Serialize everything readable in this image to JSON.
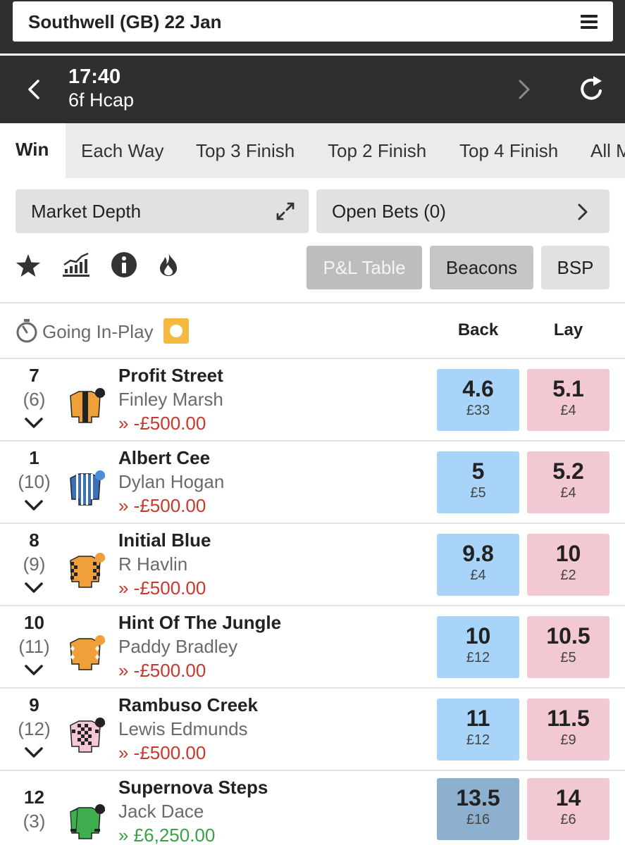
{
  "header": {
    "meeting_title": "Southwell (GB) 22 Jan",
    "menu_icon": "hamburger-menu-icon"
  },
  "race": {
    "time": "17:40",
    "description": "6f Hcap",
    "prev_icon": "chevron-left-icon",
    "next_icon": "chevron-right-icon",
    "refresh_icon": "refresh-icon"
  },
  "tabs": [
    {
      "label": "Win",
      "active": true
    },
    {
      "label": "Each Way"
    },
    {
      "label": "Top 3 Finish"
    },
    {
      "label": "Top 2 Finish"
    },
    {
      "label": "Top 4 Finish"
    },
    {
      "label": "All M"
    }
  ],
  "controls": {
    "market_depth_label": "Market Depth",
    "open_bets_label": "Open Bets",
    "open_bets_count": "(0)",
    "pl_table_label": "P&L Table",
    "beacons_label": "Beacons",
    "bsp_label": "BSP"
  },
  "icons": [
    "star-icon",
    "chart-icon",
    "info-icon",
    "flame-icon"
  ],
  "market": {
    "in_play_label": "Going In-Play",
    "back_header": "Back",
    "lay_header": "Lay"
  },
  "colors": {
    "back": "#a9d4f9",
    "back_selected": "#8eb0cf",
    "lay": "#f2c9d2",
    "loss": "#c8382e",
    "profit": "#3aa146",
    "in_play_badge": "#f5b942"
  },
  "runners": [
    {
      "number": "7",
      "draw": "(6)",
      "name": "Profit Street",
      "jockey": "Finley Marsh",
      "pl": "» -£500.00",
      "pl_sign": "neg",
      "back_odds": "4.6",
      "back_stake": "£33",
      "lay_odds": "5.1",
      "lay_stake": "£4",
      "silk": "orange-black-stripe"
    },
    {
      "number": "1",
      "draw": "(10)",
      "name": "Albert Cee",
      "jockey": "Dylan Hogan",
      "pl": "» -£500.00",
      "pl_sign": "neg",
      "back_odds": "5",
      "back_stake": "£5",
      "lay_odds": "5.2",
      "lay_stake": "£4",
      "silk": "blue-white-stripes"
    },
    {
      "number": "8",
      "draw": "(9)",
      "name": "Initial Blue",
      "jockey": "R Havlin",
      "pl": "» -£500.00",
      "pl_sign": "neg",
      "back_odds": "9.8",
      "back_stake": "£4",
      "lay_odds": "10",
      "lay_stake": "£2",
      "silk": "orange-check-sleeves"
    },
    {
      "number": "10",
      "draw": "(11)",
      "name": "Hint Of The Jungle",
      "jockey": "Paddy Bradley",
      "pl": "» -£500.00",
      "pl_sign": "neg",
      "back_odds": "10",
      "back_stake": "£12",
      "lay_odds": "10.5",
      "lay_stake": "£5",
      "silk": "orange-white-diamonds"
    },
    {
      "number": "9",
      "draw": "(12)",
      "name": "Rambuso Creek",
      "jockey": "Lewis Edmunds",
      "pl": "» -£500.00",
      "pl_sign": "neg",
      "back_odds": "11",
      "back_stake": "£12",
      "lay_odds": "11.5",
      "lay_stake": "£9",
      "silk": "pink-black-check"
    },
    {
      "number": "12",
      "draw": "(3)",
      "name": "Supernova Steps",
      "jockey": "Jack Dace",
      "pl": "» £6,250.00",
      "pl_sign": "pos",
      "back_odds": "13.5",
      "back_stake": "£16",
      "lay_odds": "14",
      "lay_stake": "£6",
      "silk": "green-black-sleeves",
      "back_selected": true
    }
  ]
}
